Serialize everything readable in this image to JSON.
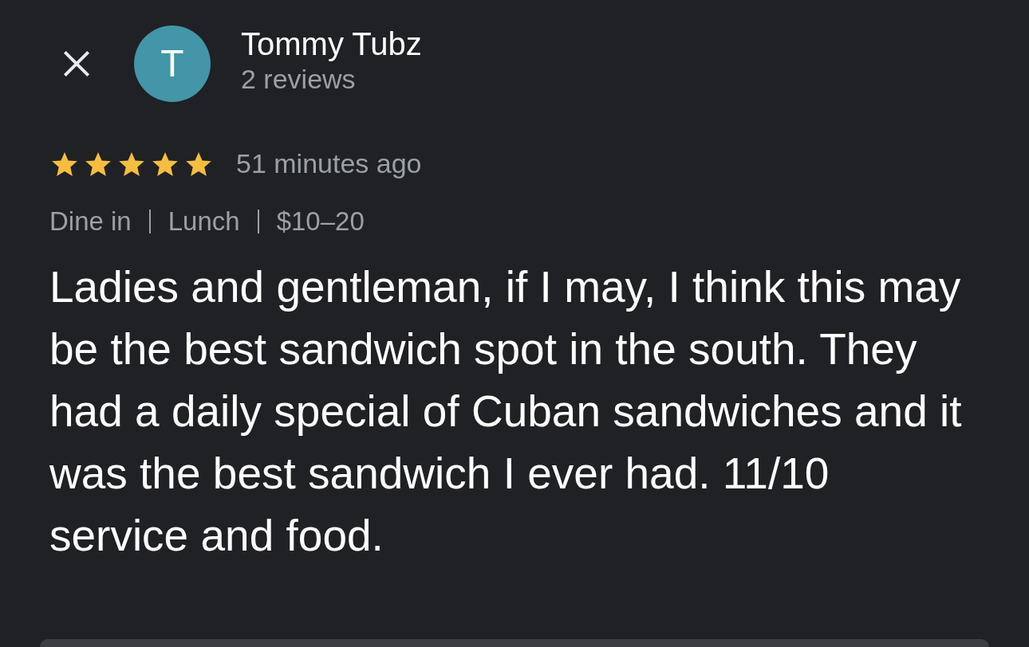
{
  "reviewer": {
    "initial": "T",
    "color": "#4395a8",
    "name": "Tommy Tubz",
    "count": "2 reviews"
  },
  "review": {
    "stars": 5,
    "time": "51 minutes ago",
    "tags": [
      "Dine in",
      "Lunch",
      "$10–20"
    ],
    "text": "Ladies and gentleman, if I may, I think this may be the best sandwich spot in the south. They had a daily special of Cuban sandwiches and it was the best sandwich I ever had. 11/10 service and food."
  }
}
